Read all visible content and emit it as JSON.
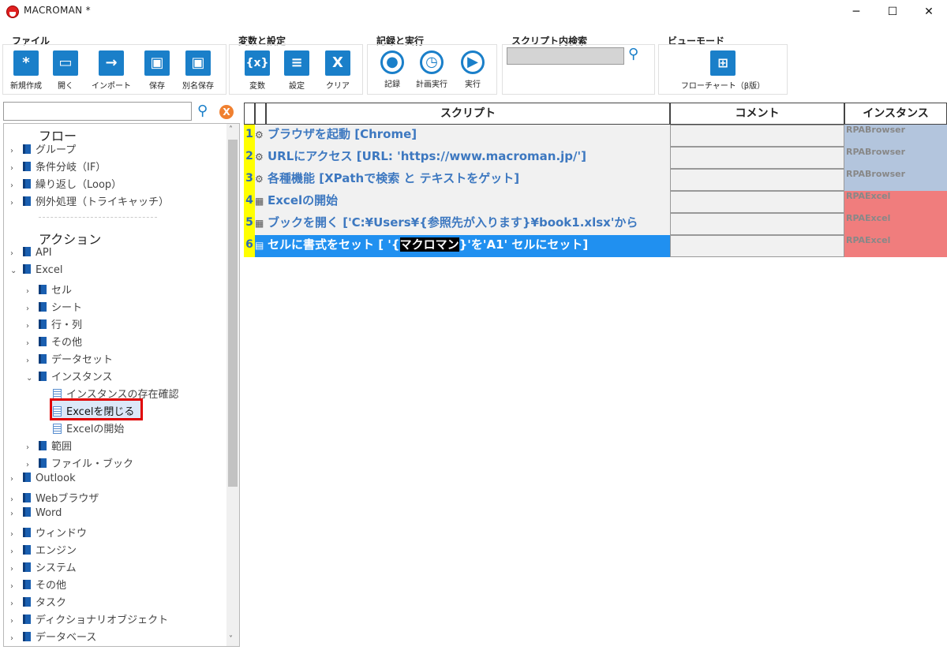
{
  "window": {
    "title": "MACROMAN *",
    "minimize": "─",
    "maximize": "☐",
    "close": "✕"
  },
  "ribbon": {
    "groups": {
      "file": {
        "title": "ファイル",
        "buttons": [
          "新規作成",
          "開く",
          "インポート",
          "保存",
          "別名保存"
        ]
      },
      "vars": {
        "title": "変数と設定",
        "buttons": [
          "変数",
          "設定",
          "クリア"
        ]
      },
      "record": {
        "title": "記録と実行",
        "buttons": [
          "記録",
          "計画実行",
          "実行"
        ]
      },
      "search": {
        "title": "スクリプト内検索"
      },
      "view": {
        "title": "ビューモード",
        "buttons": [
          "フローチャート（β版）"
        ]
      }
    },
    "icon_glyphs": {
      "new": "*",
      "open": "▭",
      "import": "→",
      "save": "▣",
      "saveas": "▣",
      "vars": "{x}",
      "settings": "≡",
      "clear": "X",
      "record": "●",
      "schedule": "◷",
      "run": "▶",
      "flowchart": "⊞"
    }
  },
  "tree": {
    "flow_header": "フロー",
    "flow_items": [
      "グループ",
      "条件分岐（IF）",
      "繰り返し（Loop）",
      "例外処理（トライキャッチ）"
    ],
    "action_header": "アクション",
    "actions": {
      "api": "API",
      "excel": "Excel",
      "excel_children": [
        "セル",
        "シート",
        "行・列",
        "その他",
        "データセット",
        "インスタンス"
      ],
      "instance_children": [
        "インスタンスの存在確認",
        "Excelを閉じる",
        "Excelの開始"
      ],
      "excel_more": [
        "範囲",
        "ファイル・ブック"
      ],
      "others": [
        "Outlook",
        "Webブラウザ",
        "Word",
        "ウィンドウ",
        "エンジン",
        "システム",
        "その他",
        "タスク",
        "ディクショナリオブジェクト",
        "データベース"
      ]
    },
    "arrow_closed": "›",
    "arrow_open": "⌄",
    "clear_label": "X"
  },
  "grid": {
    "headers": {
      "script": "スクリプト",
      "comment": "コメント",
      "instance": "インスタンス"
    },
    "rows": [
      {
        "num": "1",
        "icon": "⚙",
        "text": "ブラウザを起動 [Chrome]",
        "instance": "RPABrowser"
      },
      {
        "num": "2",
        "icon": "⚙",
        "text": "URLにアクセス [URL: 'https://www.macroman.jp/']",
        "instance": "RPABrowser"
      },
      {
        "num": "3",
        "icon": "⚙",
        "text": "各種機能 [XPathで検索 と テキストをゲット]",
        "instance": "RPABrowser"
      },
      {
        "num": "4",
        "icon": "▦",
        "text": "Excelの開始",
        "instance": "RPAExcel"
      },
      {
        "num": "5",
        "icon": "▦",
        "text": "ブックを開く ['C:¥Users¥{参照先が入ります}¥book1.xlsx'から",
        "instance": "RPAExcel"
      },
      {
        "num": "6",
        "icon": "▤",
        "text_a": "セルに書式をセット [ '{",
        "text_hl": "マクロマン",
        "text_b": "}'を'A1' セルにセット]",
        "instance": "RPAExcel"
      }
    ]
  },
  "colors": {
    "accent": "#1a7fc9",
    "selected": "#2090f0",
    "browser": "#b3c5dd",
    "excel": "#f07d7d",
    "rownum": "#ffff00",
    "highlight": "#e00000"
  }
}
